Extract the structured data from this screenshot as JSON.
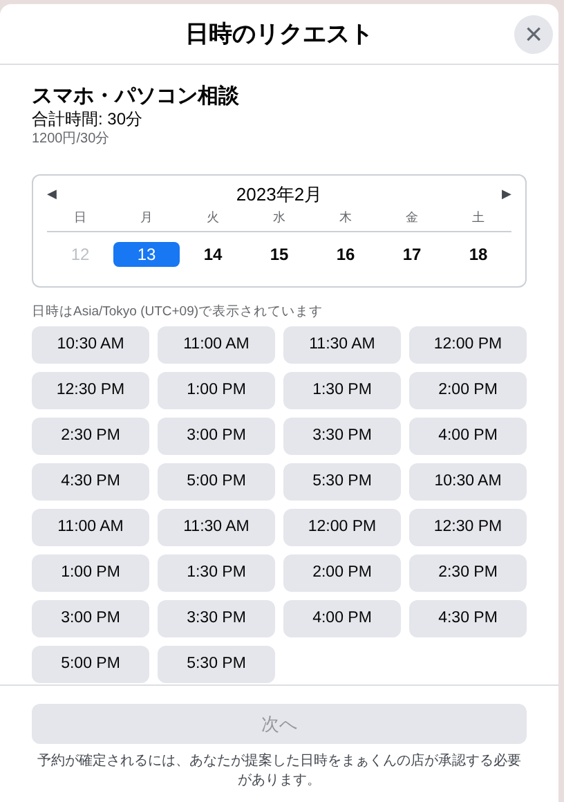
{
  "dialog": {
    "title": "日時のリクエスト",
    "close": "×"
  },
  "service": {
    "name": "スマホ・パソコン相談",
    "duration": "合計時間: 30分",
    "price": "1200円/30分"
  },
  "calendar": {
    "prev": "◀",
    "month": "2023年2月",
    "next": "▶",
    "weekdays": [
      "日",
      "月",
      "火",
      "水",
      "木",
      "金",
      "土"
    ],
    "days": [
      {
        "label": "12",
        "selected": false,
        "disabled": true
      },
      {
        "label": "13",
        "selected": true,
        "disabled": false
      },
      {
        "label": "14",
        "selected": false,
        "disabled": false
      },
      {
        "label": "15",
        "selected": false,
        "disabled": false
      },
      {
        "label": "16",
        "selected": false,
        "disabled": false
      },
      {
        "label": "17",
        "selected": false,
        "disabled": false
      },
      {
        "label": "18",
        "selected": false,
        "disabled": false
      }
    ]
  },
  "timezone_note": "日時はAsia/Tokyo (UTC+09)で表示されています",
  "time_slots": [
    "10:30 AM",
    "11:00 AM",
    "11:30 AM",
    "12:00 PM",
    "12:30 PM",
    "1:00 PM",
    "1:30 PM",
    "2:00 PM",
    "2:30 PM",
    "3:00 PM",
    "3:30 PM",
    "4:00 PM",
    "4:30 PM",
    "5:00 PM",
    "5:30 PM",
    "10:30 AM",
    "11:00 AM",
    "11:30 AM",
    "12:00 PM",
    "12:30 PM",
    "1:00 PM",
    "1:30 PM",
    "2:00 PM",
    "2:30 PM",
    "3:00 PM",
    "3:30 PM",
    "4:00 PM",
    "4:30 PM",
    "5:00 PM",
    "5:30 PM"
  ],
  "next_button": {
    "label": "次へ",
    "disabled": true
  },
  "footer_note": "予約が確定されるには、あなたが提案した日時をまぁくんの店が承認する必要があります。"
}
